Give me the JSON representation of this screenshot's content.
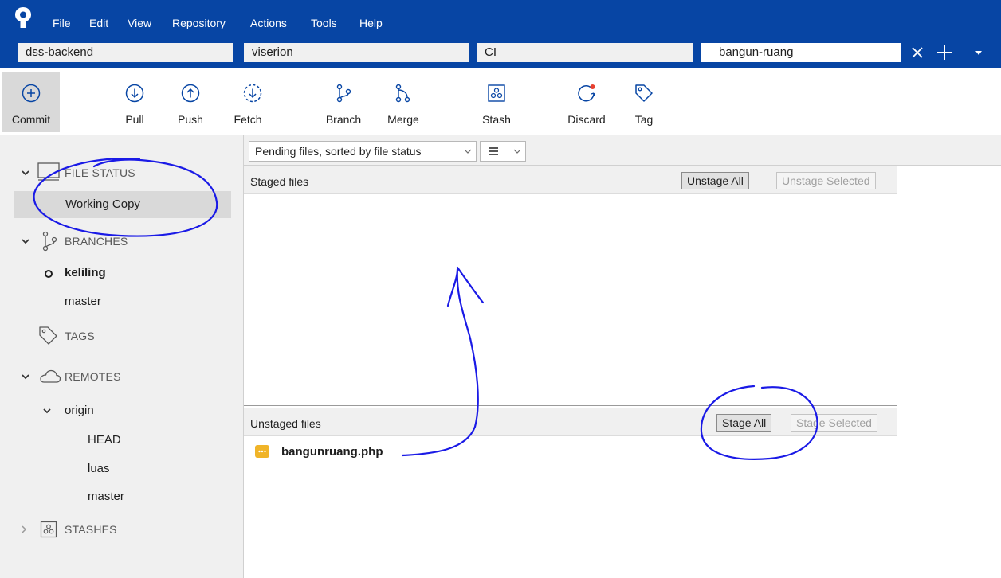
{
  "menu": {
    "items": [
      "File",
      "Edit",
      "View",
      "Repository",
      "Actions",
      "Tools",
      "Help"
    ]
  },
  "tabs": [
    {
      "label": "dss-backend",
      "active": false
    },
    {
      "label": "viserion",
      "active": false
    },
    {
      "label": "CI",
      "active": false
    },
    {
      "label": "bangun-ruang",
      "active": true
    }
  ],
  "toolbar": {
    "commit": "Commit",
    "pull": "Pull",
    "push": "Push",
    "fetch": "Fetch",
    "branch": "Branch",
    "merge": "Merge",
    "stash": "Stash",
    "discard": "Discard",
    "tag": "Tag"
  },
  "sidebar": {
    "file_status": {
      "label": "FILE STATUS",
      "icon": "monitor-icon",
      "items": [
        "Working Copy"
      ]
    },
    "branches": {
      "label": "BRANCHES",
      "icon": "branch-icon",
      "current": "keliling",
      "items": [
        "keliling",
        "master"
      ]
    },
    "tags": {
      "label": "TAGS",
      "icon": "tag-icon"
    },
    "remotes": {
      "label": "REMOTES",
      "icon": "cloud-icon",
      "origin": {
        "label": "origin",
        "items": [
          "HEAD",
          "luas",
          "master"
        ]
      }
    },
    "stashes": {
      "label": "STASHES",
      "icon": "stash-icon"
    }
  },
  "filter": {
    "sort_label": "Pending files, sorted by file status",
    "view_mode_icon": "list-icon"
  },
  "staged": {
    "title": "Staged files",
    "unstage_all": "Unstage All",
    "unstage_selected": "Unstage Selected"
  },
  "unstaged": {
    "title": "Unstaged files",
    "stage_all": "Stage All",
    "stage_selected": "Stage Selected",
    "files": [
      {
        "name": "bangunruang.php",
        "status": "modified"
      }
    ]
  },
  "colors": {
    "accent": "#0745a4",
    "annotation": "#1a1ae6",
    "modified_badge": "#f0b428",
    "discard_dot": "#e8402f"
  }
}
